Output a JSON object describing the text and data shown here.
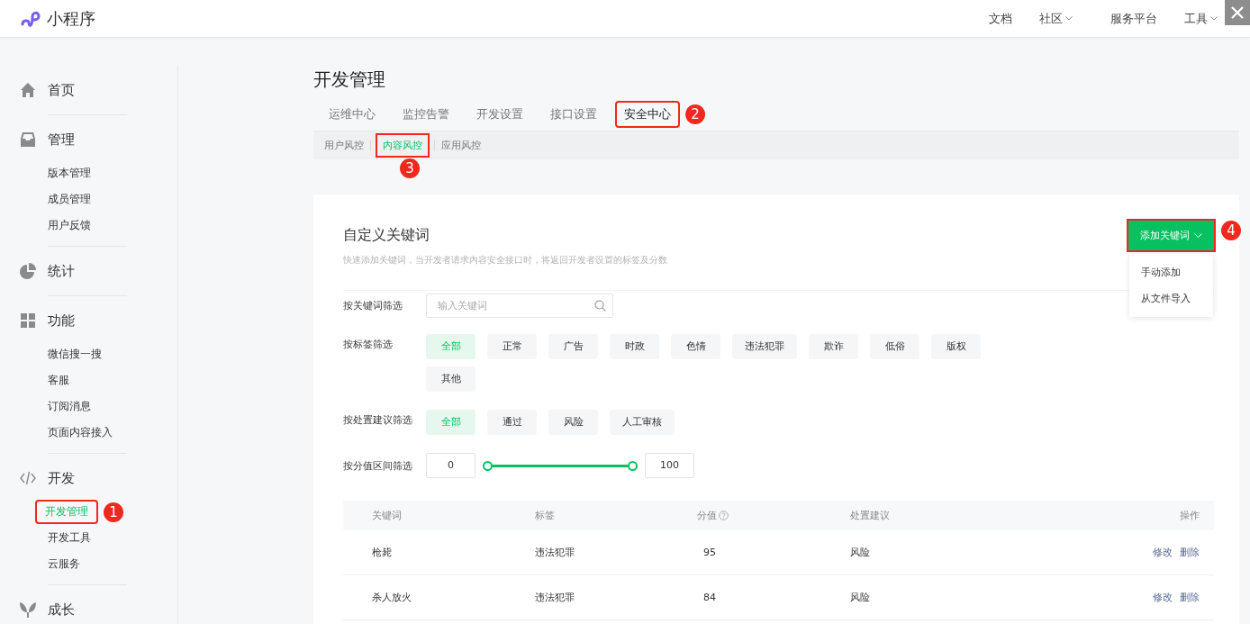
{
  "header": {
    "logo_text": "小程序",
    "nav": [
      {
        "label": "文档",
        "dropdown": false
      },
      {
        "label": "社区",
        "dropdown": true
      },
      {
        "label": "服务平台",
        "dropdown": false
      },
      {
        "label": "工具",
        "dropdown": true
      }
    ]
  },
  "sidebar": {
    "sections": [
      {
        "label": "首页"
      },
      {
        "label": "管理",
        "items": [
          {
            "label": "版本管理",
            "selected": false
          },
          {
            "label": "成员管理",
            "selected": false
          },
          {
            "label": "用户反馈",
            "selected": false
          }
        ]
      },
      {
        "label": "统计"
      },
      {
        "label": "功能",
        "items": [
          {
            "label": "微信搜一搜",
            "selected": false
          },
          {
            "label": "客服",
            "selected": false
          },
          {
            "label": "订阅消息",
            "selected": false
          },
          {
            "label": "页面内容接入",
            "selected": false
          }
        ]
      },
      {
        "label": "开发",
        "items": [
          {
            "label": "开发管理",
            "selected": true,
            "annotation": "1"
          },
          {
            "label": "开发工具",
            "selected": false
          },
          {
            "label": "云服务",
            "selected": false
          }
        ]
      },
      {
        "label": "成长"
      }
    ]
  },
  "page_title": "开发管理",
  "tabs": [
    {
      "label": "运维中心",
      "selected": false
    },
    {
      "label": "监控告警",
      "selected": false
    },
    {
      "label": "开发设置",
      "selected": false
    },
    {
      "label": "接口设置",
      "selected": false
    },
    {
      "label": "安全中心",
      "selected": true,
      "annotation": "2"
    }
  ],
  "subtabs": [
    {
      "label": "用户风控",
      "selected": false
    },
    {
      "label": "内容风控",
      "selected": true,
      "annotation": "3"
    },
    {
      "label": "应用风控",
      "selected": false
    }
  ],
  "card": {
    "title": "自定义关键词",
    "description": "快速添加关键词，当开发者请求内容安全接口时，将返回开发者设置的标签及分数",
    "add_button": {
      "label": "添加关键词",
      "annotation": "4"
    },
    "menu": [
      "手动添加",
      "从文件导入"
    ],
    "keyword_filter": {
      "label": "按关键词筛选",
      "placeholder": "输入关键词"
    },
    "tag_filter": {
      "label": "按标签筛选",
      "options": [
        {
          "label": "全部",
          "selected": true
        },
        {
          "label": "正常",
          "selected": false
        },
        {
          "label": "广告",
          "selected": false
        },
        {
          "label": "时政",
          "selected": false
        },
        {
          "label": "色情",
          "selected": false
        },
        {
          "label": "违法犯罪",
          "selected": false
        },
        {
          "label": "欺诈",
          "selected": false
        },
        {
          "label": "低俗",
          "selected": false
        },
        {
          "label": "版权",
          "selected": false
        },
        {
          "label": "其他",
          "selected": false
        }
      ]
    },
    "advice_filter": {
      "label": "按处置建议筛选",
      "options": [
        {
          "label": "全部",
          "selected": true
        },
        {
          "label": "通过",
          "selected": false
        },
        {
          "label": "风险",
          "selected": false
        },
        {
          "label": "人工审核",
          "selected": false
        }
      ]
    },
    "score_filter": {
      "label": "按分值区间筛选",
      "min": "0",
      "max": "100",
      "low": {
        "level": 0
      },
      "high": {
        "level": 1
      }
    },
    "table": {
      "columns": [
        {
          "label": "关键词",
          "help": false
        },
        {
          "label": "标签",
          "help": false
        },
        {
          "label": "分值",
          "help": true
        },
        {
          "label": "处置建议",
          "help": false
        },
        {
          "label": "操作",
          "help": false
        }
      ],
      "rows": [
        {
          "keyword": "枪毙",
          "tag": "违法犯罪",
          "score": "95",
          "advice": "风险",
          "actions": [
            "修改",
            "删除"
          ]
        },
        {
          "keyword": "杀人放火",
          "tag": "违法犯罪",
          "score": "84",
          "advice": "风险",
          "actions": [
            "修改",
            "删除"
          ]
        }
      ]
    }
  }
}
